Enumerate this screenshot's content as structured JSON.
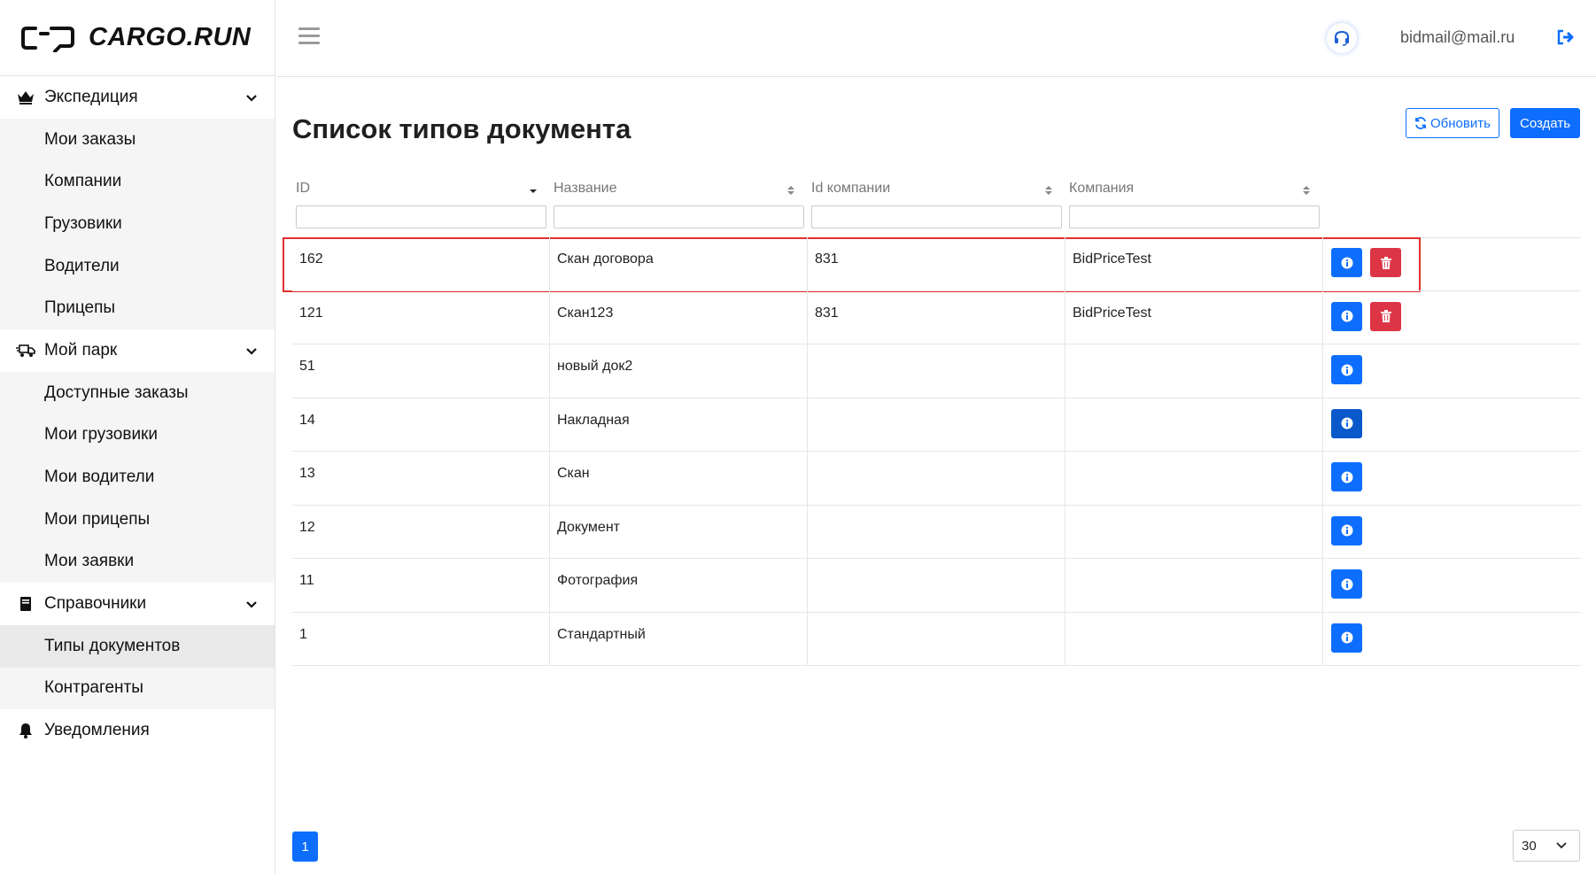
{
  "brand": {
    "name": "CARGO.RUN"
  },
  "sidebar": {
    "groups": [
      {
        "label": "Экспедиция",
        "icon": "crown-icon",
        "items": [
          {
            "label": "Мои заказы"
          },
          {
            "label": "Компании"
          },
          {
            "label": "Грузовики"
          },
          {
            "label": "Водители"
          },
          {
            "label": "Прицепы"
          }
        ]
      },
      {
        "label": "Мой парк",
        "icon": "truck-icon",
        "items": [
          {
            "label": "Доступные заказы"
          },
          {
            "label": "Мои грузовики"
          },
          {
            "label": "Мои водители"
          },
          {
            "label": "Мои прицепы"
          },
          {
            "label": "Мои заявки"
          }
        ]
      },
      {
        "label": "Справочники",
        "icon": "book-icon",
        "items": [
          {
            "label": "Типы документов",
            "active": true
          },
          {
            "label": "Контрагенты"
          }
        ]
      },
      {
        "label": "Уведомления",
        "icon": "bell-icon"
      }
    ]
  },
  "header": {
    "email": "bidmail@mail.ru"
  },
  "page": {
    "title": "Список типов документа",
    "refresh_label": "Обновить",
    "create_label": "Создать"
  },
  "table": {
    "columns": [
      {
        "label": "ID",
        "sort": "desc"
      },
      {
        "label": "Название",
        "sort": "none"
      },
      {
        "label": "Id компании",
        "sort": "none"
      },
      {
        "label": "Компания",
        "sort": "none"
      }
    ],
    "rows": [
      {
        "id": "162",
        "name": "Скан договора",
        "company_id": "831",
        "company": "BidPriceTest",
        "deletable": true,
        "highlighted": true
      },
      {
        "id": "121",
        "name": "Скан123",
        "company_id": "831",
        "company": "BidPriceTest",
        "deletable": true
      },
      {
        "id": "51",
        "name": "новый док2",
        "company_id": "",
        "company": "",
        "deletable": false
      },
      {
        "id": "14",
        "name": "Накладная",
        "company_id": "",
        "company": "",
        "deletable": false,
        "focused": true
      },
      {
        "id": "13",
        "name": "Скан",
        "company_id": "",
        "company": "",
        "deletable": false
      },
      {
        "id": "12",
        "name": "Документ",
        "company_id": "",
        "company": "",
        "deletable": false
      },
      {
        "id": "11",
        "name": "Фотография",
        "company_id": "",
        "company": "",
        "deletable": false
      },
      {
        "id": "1",
        "name": "Стандартный",
        "company_id": "",
        "company": "",
        "deletable": false
      }
    ]
  },
  "pagination": {
    "current_page": "1",
    "page_size": "30"
  },
  "colors": {
    "primary": "#0d6efd",
    "danger": "#dc3545",
    "highlight": "#e32f2f"
  }
}
